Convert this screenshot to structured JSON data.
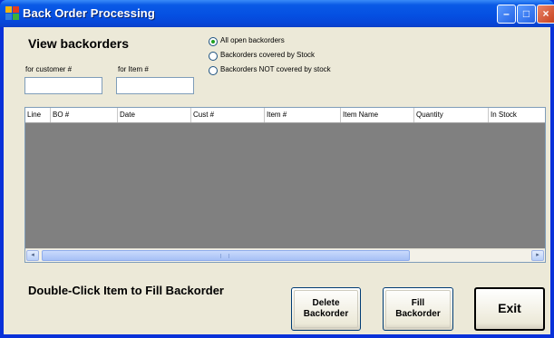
{
  "window": {
    "title": "Back Order Processing",
    "controls": {
      "minimize": "–",
      "maximize": "□",
      "close": "×"
    }
  },
  "form": {
    "heading": "View backorders",
    "customer_label": "for customer #",
    "customer_value": "",
    "item_label": "for Item #",
    "item_value": ""
  },
  "filters": {
    "options": [
      {
        "label": "All open backorders",
        "selected": true
      },
      {
        "label": "Backorders covered by Stock",
        "selected": false
      },
      {
        "label": "Backorders NOT covered by stock",
        "selected": false
      }
    ]
  },
  "grid": {
    "columns": [
      "Line",
      "BO #",
      "Date",
      "Cust #",
      "Item #",
      "Item Name",
      "Quantity",
      "In Stock"
    ],
    "rows": [],
    "scroll_left": "◂",
    "scroll_right": "▸"
  },
  "hint": "Double-Click Item to Fill Backorder",
  "buttons": {
    "delete": "Delete\nBackorder",
    "fill": "Fill\nBackorder",
    "exit": "Exit"
  },
  "colors": {
    "title_bar": "#0550e2",
    "client_background": "#ece9d8",
    "grid_background": "#808080",
    "selected_radio": "#21a121"
  }
}
